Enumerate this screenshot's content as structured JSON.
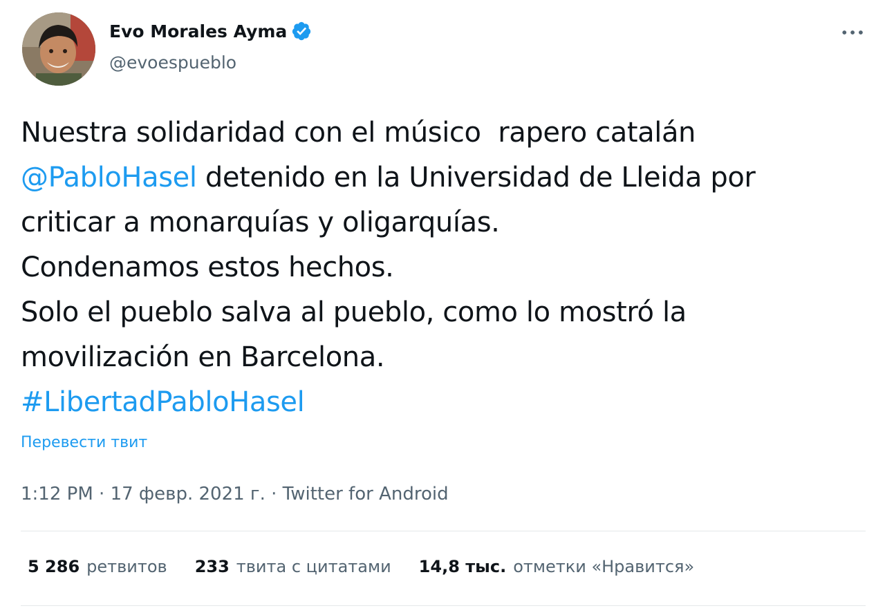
{
  "author": {
    "display_name": "Evo Morales Ayma",
    "handle": "@evoespueblo",
    "verified": true
  },
  "tweet": {
    "lines": [
      [
        {
          "text": "Nuestra solidaridad con el músico  rapero catalán",
          "link": false
        }
      ],
      [
        {
          "text": "@PabloHasel",
          "link": true
        },
        {
          "text": " detenido en la Universidad de Lleida por",
          "link": false
        }
      ],
      [
        {
          "text": "criticar a monarquías y oligarquías.",
          "link": false
        }
      ],
      [
        {
          "text": "Condenamos estos hechos.",
          "link": false
        }
      ],
      [
        {
          "text": "Solo el pueblo salva al pueblo, como lo mostró la",
          "link": false
        }
      ],
      [
        {
          "text": "movilización en Barcelona.",
          "link": false
        }
      ],
      [
        {
          "text": "#LibertadPabloHasel",
          "link": true
        }
      ]
    ],
    "translate_label": "Перевести твит",
    "time": "1:12 PM",
    "date": "17 февр. 2021 г.",
    "source": "Twitter for Android",
    "separator": " · "
  },
  "stats": {
    "retweets": {
      "num": "5 286",
      "label": "ретвитов"
    },
    "quotes": {
      "num": "233",
      "label": "твита с цитатами"
    },
    "likes": {
      "num": "14,8 тыс.",
      "label": "отметки «Нравится»"
    }
  },
  "colors": {
    "link": "#1d9bf0",
    "secondary_text": "#536471",
    "primary_text": "#0f1419",
    "divider": "#e4e7e9"
  },
  "icons": {
    "verified": "verified-badge-icon",
    "more": "more-horizontal-icon"
  }
}
